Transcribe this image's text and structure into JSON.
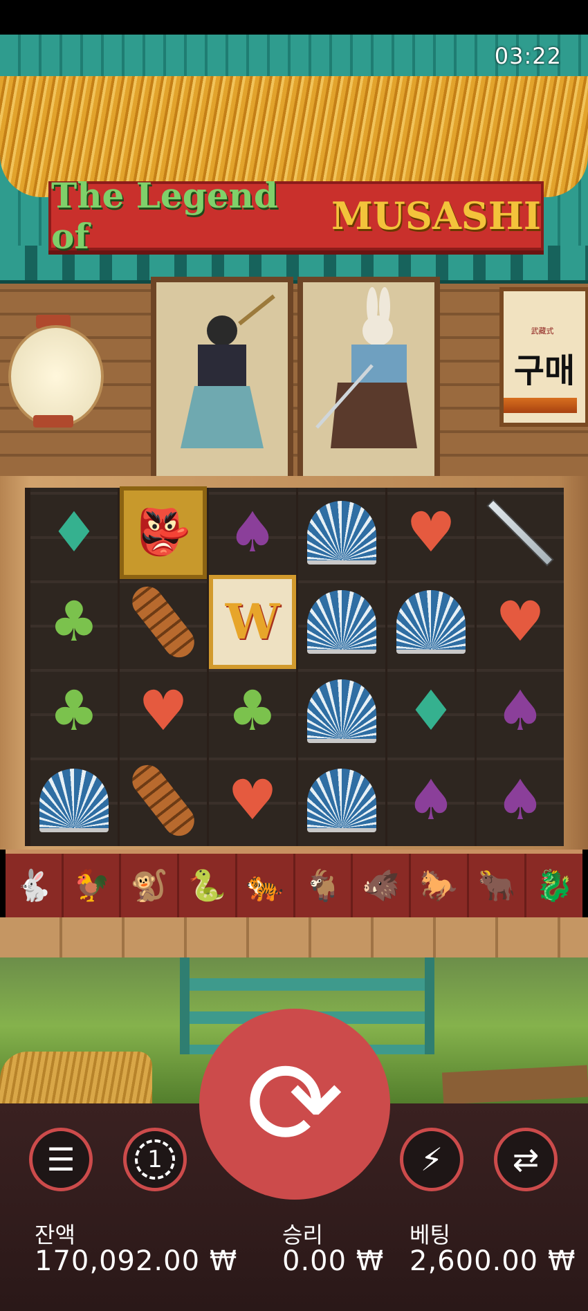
{
  "status_bar": {
    "time": "03:22"
  },
  "game": {
    "title_part1": "The Legend of",
    "title_part2": "MUSASHI",
    "shop_label": "구매",
    "shop_stamp": "武藏式"
  },
  "reels": [
    [
      "diamond",
      "club",
      "club",
      "fan"
    ],
    [
      "samurai",
      "war-club",
      "heart",
      "war-club"
    ],
    [
      "spade",
      "wild",
      "club",
      "heart"
    ],
    [
      "fan",
      "fan",
      "fan",
      "fan"
    ],
    [
      "heart",
      "fan",
      "diamond",
      "spade"
    ],
    [
      "katana",
      "heart",
      "spade",
      "spade"
    ]
  ],
  "zodiac_row": [
    "rabbit",
    "rooster",
    "monkey",
    "snake",
    "tiger",
    "goat",
    "boar",
    "horse",
    "ox",
    "dragon"
  ],
  "controls": {
    "menu_icon": "hamburger-icon",
    "bet_level": "1",
    "spin_icon": "spin-icon",
    "turbo_icon": "turbo-off-icon",
    "autoplay_icon": "autoplay-icon"
  },
  "hud": {
    "balance_label": "잔액",
    "balance_value": "170,092.00 ₩",
    "win_label": "승리",
    "win_value": "0.00 ₩",
    "bet_label": "베팅",
    "bet_value": "2,600.00 ₩"
  }
}
